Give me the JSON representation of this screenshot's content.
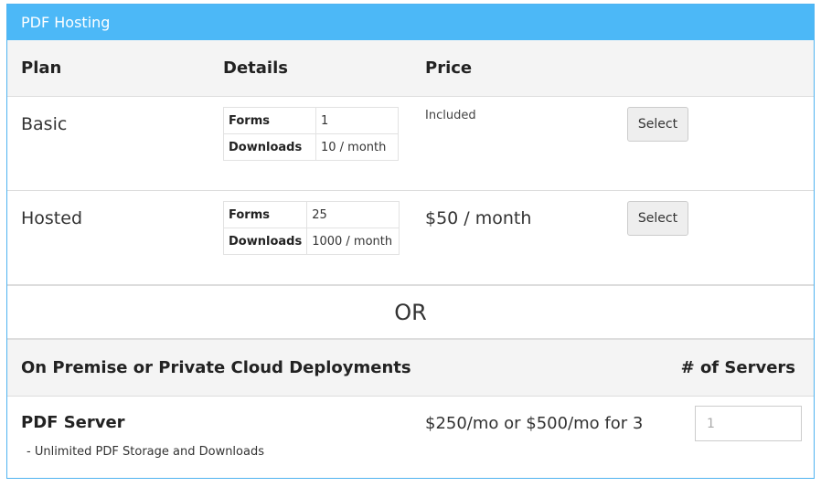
{
  "panel": {
    "title": "PDF Hosting"
  },
  "plans_header": {
    "plan": "Plan",
    "details": "Details",
    "price": "Price"
  },
  "plans": [
    {
      "name": "Basic",
      "details": [
        {
          "key": "Forms",
          "value": "1"
        },
        {
          "key": "Downloads",
          "value": "10 / month"
        }
      ],
      "price": "Included",
      "select_label": "Select"
    },
    {
      "name": "Hosted",
      "details": [
        {
          "key": "Forms",
          "value": "25"
        },
        {
          "key": "Downloads",
          "value": "1000 / month"
        }
      ],
      "price": "$50 / month",
      "select_label": "Select"
    }
  ],
  "separator": "OR",
  "premise": {
    "header_title": "On Premise or Private Cloud Deployments",
    "header_servers": "# of Servers",
    "product_name": "PDF Server",
    "product_note": "- Unlimited PDF Storage and Downloads",
    "price": "$250/mo or $500/mo for 3",
    "servers_placeholder": "1"
  },
  "colors": {
    "heading_bg": "#4cb8f7",
    "panel_border": "#4fb3f0"
  }
}
